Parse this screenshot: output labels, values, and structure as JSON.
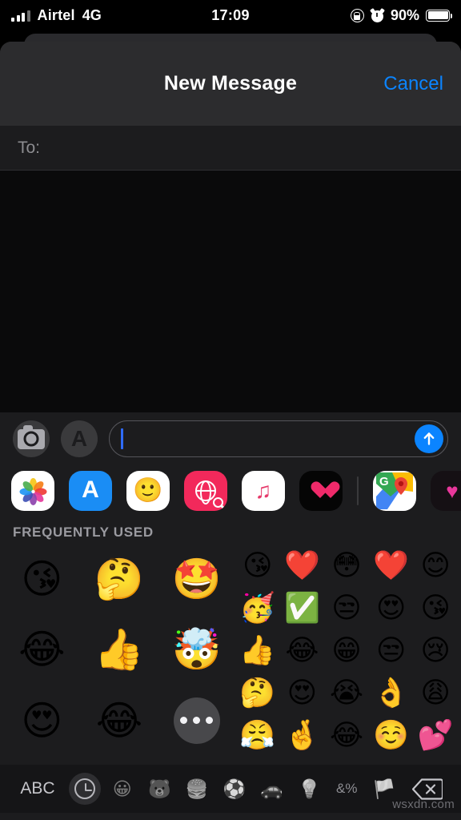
{
  "statusbar": {
    "carrier": "Airtel",
    "network": "4G",
    "time": "17:09",
    "battery_percent": "90%",
    "icons": [
      "signal-bars-icon",
      "rotation-lock-icon",
      "alarm-icon",
      "battery-icon"
    ]
  },
  "navbar": {
    "title": "New Message",
    "cancel_label": "Cancel",
    "cancel_color": "#0b84ff"
  },
  "recipient": {
    "label": "To:",
    "value": "",
    "placeholder": ""
  },
  "compose": {
    "camera_icon": "camera-icon",
    "appstore_icon": "app-store-icon",
    "input_value": "",
    "input_placeholder": "",
    "send_icon": "send-arrow-up-icon",
    "send_color": "#0b84ff"
  },
  "app_drawer": {
    "apps": [
      {
        "name": "photos",
        "label": "Photos"
      },
      {
        "name": "app-store",
        "label": "App Store"
      },
      {
        "name": "memoji",
        "label": "Memoji"
      },
      {
        "name": "images",
        "label": "#images"
      },
      {
        "name": "apple-music",
        "label": "Apple Music"
      },
      {
        "name": "fitness",
        "label": "Fitness"
      },
      {
        "name": "google-maps",
        "label": "Google Maps"
      },
      {
        "name": "partial-app",
        "label": ""
      }
    ]
  },
  "keyboard": {
    "section_title": "FREQUENTLY USED",
    "memoji_stickers": [
      {
        "glyph": "😘",
        "name": "memoji-kiss-heart"
      },
      {
        "glyph": "🤔",
        "name": "memoji-thinking"
      },
      {
        "glyph": "🤩",
        "name": "memoji-star-struck"
      },
      {
        "glyph": "😂",
        "name": "memoji-laughing-tears"
      },
      {
        "glyph": "👍",
        "name": "memoji-thumbs-up"
      },
      {
        "glyph": "🤯",
        "name": "memoji-mind-blown"
      },
      {
        "glyph": "😍",
        "name": "memoji-heart-eyes"
      },
      {
        "glyph": "😂",
        "name": "memoji-joy"
      },
      {
        "glyph": "•••",
        "name": "memoji-more-button"
      }
    ],
    "emojis": [
      {
        "glyph": "😘",
        "name": "emoji-kissing-heart"
      },
      {
        "glyph": "❤️",
        "name": "emoji-red-heart"
      },
      {
        "glyph": "😳",
        "name": "emoji-flushed"
      },
      {
        "glyph": "❤️",
        "name": "emoji-red-heart"
      },
      {
        "glyph": "😊",
        "name": "emoji-smiling-blush"
      },
      {
        "glyph": "🥳",
        "name": "emoji-partying-face"
      },
      {
        "glyph": "✅",
        "name": "emoji-check-mark-button"
      },
      {
        "glyph": "😒",
        "name": "emoji-unamused"
      },
      {
        "glyph": "😍",
        "name": "emoji-heart-eyes"
      },
      {
        "glyph": "😘",
        "name": "emoji-kissing-heart"
      },
      {
        "glyph": "👍",
        "name": "emoji-thumbs-up"
      },
      {
        "glyph": "😂",
        "name": "emoji-joy"
      },
      {
        "glyph": "😁",
        "name": "emoji-grin"
      },
      {
        "glyph": "😒",
        "name": "emoji-unamused"
      },
      {
        "glyph": "😢",
        "name": "emoji-crying"
      },
      {
        "glyph": "🤔",
        "name": "emoji-thinking"
      },
      {
        "glyph": "😍",
        "name": "emoji-heart-eyes"
      },
      {
        "glyph": "😭",
        "name": "emoji-loudly-crying"
      },
      {
        "glyph": "👌",
        "name": "emoji-ok-hand"
      },
      {
        "glyph": "😩",
        "name": "emoji-weary"
      },
      {
        "glyph": "😤",
        "name": "emoji-face-steam"
      },
      {
        "glyph": "🤞",
        "name": "emoji-crossed-fingers"
      },
      {
        "glyph": "😂",
        "name": "emoji-joy"
      },
      {
        "glyph": "☺️",
        "name": "emoji-smiling-face"
      },
      {
        "glyph": "💕",
        "name": "emoji-two-hearts"
      }
    ],
    "toolbar": {
      "abc_label": "ABC",
      "categories": [
        {
          "glyph": "",
          "name": "recent-clock-icon",
          "selected": true
        },
        {
          "glyph": "😀",
          "name": "smileys-icon",
          "selected": false
        },
        {
          "glyph": "🐻",
          "name": "animals-icon",
          "selected": false
        },
        {
          "glyph": "🍔",
          "name": "food-icon",
          "selected": false
        },
        {
          "glyph": "⚽",
          "name": "activities-icon",
          "selected": false
        },
        {
          "glyph": "🚗",
          "name": "travel-icon",
          "selected": false
        },
        {
          "glyph": "💡",
          "name": "objects-icon",
          "selected": false
        },
        {
          "glyph": "&%",
          "name": "symbols-icon",
          "selected": false
        },
        {
          "glyph": "🏳️",
          "name": "flags-icon",
          "selected": false
        }
      ],
      "backspace_icon": "backspace-icon"
    }
  },
  "watermark": "wsxdn.com"
}
